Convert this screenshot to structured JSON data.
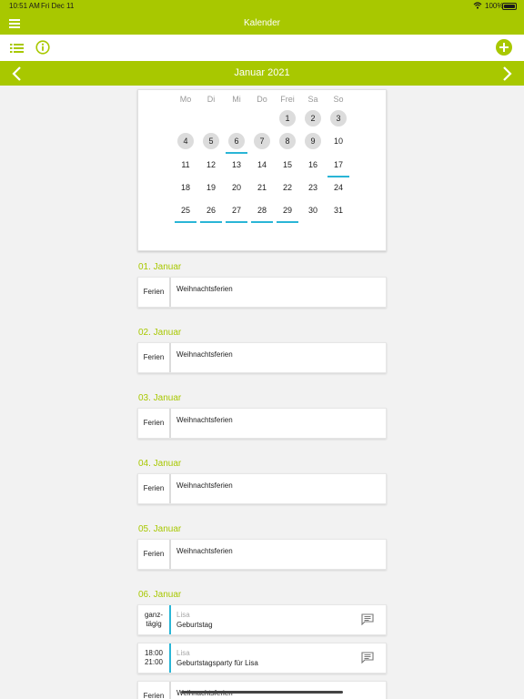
{
  "status": {
    "time": "10:51 AM",
    "date": "Fri Dec 11",
    "battery": "100%"
  },
  "header": {
    "title": "Kalender"
  },
  "toolbar": {
    "list_icon": "list-icon",
    "info_icon": "info-icon",
    "add_icon": "plus-circle-icon"
  },
  "month_nav": {
    "label": "Januar 2021",
    "prev_icon": "chevron-left-icon",
    "next_icon": "chevron-right-icon"
  },
  "calendar": {
    "weekdays": [
      "Mo",
      "Di",
      "Mi",
      "Do",
      "Frei",
      "Sa",
      "So"
    ],
    "weeks": [
      [
        null,
        null,
        null,
        null,
        "1",
        "2",
        "3"
      ],
      [
        "4",
        "5",
        "6",
        "7",
        "8",
        "9",
        "10"
      ],
      [
        "11",
        "12",
        "13",
        "14",
        "15",
        "16",
        "17"
      ],
      [
        "18",
        "19",
        "20",
        "21",
        "22",
        "23",
        "24"
      ],
      [
        "25",
        "26",
        "27",
        "28",
        "29",
        "30",
        "31"
      ]
    ],
    "past_days": [
      "1",
      "2",
      "3",
      "4",
      "5",
      "6",
      "7",
      "8",
      "9"
    ],
    "event_marked_days": [
      "6",
      "17",
      "25",
      "26",
      "27",
      "28",
      "29"
    ],
    "accent_color": "#a8c800",
    "event_color": "#2ab5d6"
  },
  "agenda": [
    {
      "date": "01. Januar",
      "events": [
        {
          "time": "Ferien",
          "title": "Weihnachtsferien"
        }
      ]
    },
    {
      "date": "02. Januar",
      "events": [
        {
          "time": "Ferien",
          "title": "Weihnachtsferien"
        }
      ]
    },
    {
      "date": "03. Januar",
      "events": [
        {
          "time": "Ferien",
          "title": "Weihnachtsferien"
        }
      ]
    },
    {
      "date": "04. Januar",
      "events": [
        {
          "time": "Ferien",
          "title": "Weihnachtsferien"
        }
      ]
    },
    {
      "date": "05. Januar",
      "events": [
        {
          "time": "Ferien",
          "title": "Weihnachtsferien"
        }
      ]
    },
    {
      "date": "06. Januar",
      "events": [
        {
          "time_line1": "ganz-",
          "time_line2": "tägig",
          "person": "Lisa",
          "title": "Geburtstag",
          "icon": "comment-icon"
        },
        {
          "time_line1": "18:00",
          "time_line2": "21:00",
          "person": "Lisa",
          "title": "Geburtstagsparty für Lisa",
          "icon": "comment-icon"
        },
        {
          "time": "Ferien",
          "title": "Weihnachtsferien"
        }
      ]
    }
  ]
}
